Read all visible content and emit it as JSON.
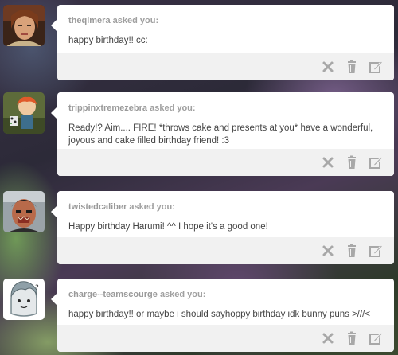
{
  "asks": [
    {
      "asker": "theqimera",
      "suffix": "asked you:",
      "message": "happy birthday!! cc:",
      "avatar_icon": "portrait-avatar-icon"
    },
    {
      "asker": "trippinxtremezebra",
      "suffix": "asked you:",
      "message": "Ready!? Aim.... FIRE! *throws cake and presents at you* have a wonderful, joyous and cake filled birthday friend! :3",
      "avatar_icon": "cartoon-avatar-icon"
    },
    {
      "asker": "twistedcaliber",
      "suffix": "asked you:",
      "message": "Happy birthday Harumi! ^^ I hope it's a good one!",
      "avatar_icon": "photo-avatar-icon"
    },
    {
      "asker": "charge--teamscourge",
      "suffix": "asked you:",
      "message": "happy birthday!! or maybe i should sayhoppy birthday idk bunny puns >///<",
      "avatar_icon": "drawing-avatar-icon"
    }
  ],
  "action_icons": [
    "delete-x-icon",
    "trash-icon",
    "edit-icon"
  ],
  "colors": {
    "card_bg": "#ffffff",
    "footer_bg": "#f1f1f1",
    "icon": "#a8a8a8",
    "asker_text": "#9a9a9a",
    "message_text": "#444444"
  }
}
